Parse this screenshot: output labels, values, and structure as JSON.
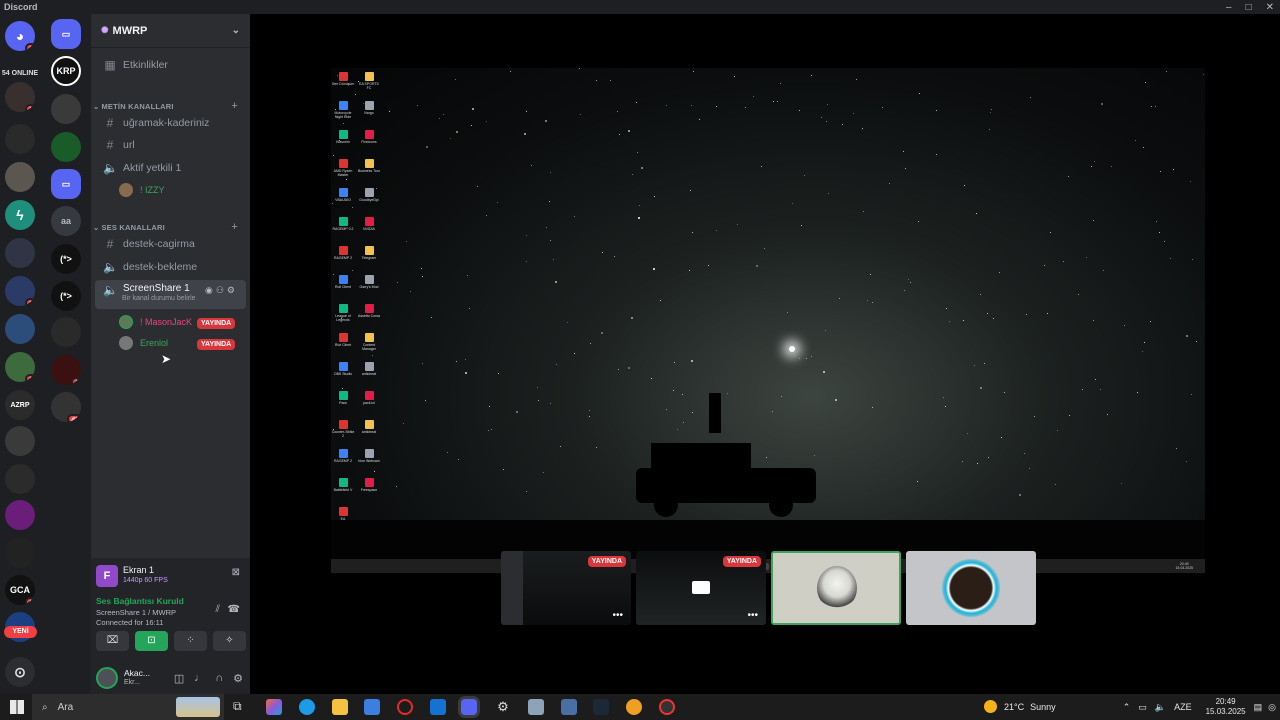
{
  "window": {
    "title": "Discord",
    "controls": [
      "–",
      "□",
      "✕"
    ]
  },
  "left_rail": {
    "online_label": "54 ONLINE",
    "new_label": "YENİ",
    "servers": [
      {
        "label": "",
        "badge": "1"
      },
      {
        "label": "",
        "badge": "2"
      },
      {
        "label": "",
        "badge": ""
      },
      {
        "label": "",
        "badge": ""
      },
      {
        "label": "",
        "badge": ""
      },
      {
        "label": "",
        "badge": ""
      },
      {
        "label": "",
        "badge": "2"
      },
      {
        "label": "",
        "badge": ""
      },
      {
        "label": "",
        "badge": "1"
      },
      {
        "label": "AZRP",
        "badge": ""
      },
      {
        "label": "",
        "badge": ""
      },
      {
        "label": "",
        "badge": ""
      },
      {
        "label": "",
        "badge": ""
      },
      {
        "label": "",
        "badge": ""
      },
      {
        "label": "GCA",
        "badge": "1"
      },
      {
        "label": "",
        "badge": ""
      }
    ]
  },
  "second_rail": {
    "servers": [
      {
        "label": "",
        "badge": ""
      },
      {
        "label": "KRP",
        "badge": ""
      },
      {
        "label": "",
        "badge": ""
      },
      {
        "label": "",
        "badge": ""
      },
      {
        "label": "",
        "badge": ""
      },
      {
        "label": "aa",
        "badge": ""
      },
      {
        "label": "(*>",
        "badge": ""
      },
      {
        "label": "(*>",
        "badge": ""
      },
      {
        "label": "",
        "badge": ""
      },
      {
        "label": "",
        "badge": "1"
      },
      {
        "label": "",
        "badge": "42"
      }
    ]
  },
  "server": {
    "name": "MWRP",
    "events_label": "Etkinlikler",
    "categories": {
      "text": "METİN KANALLARI",
      "voice": "SES KANALLARI"
    },
    "channels": {
      "text1": "uğramak-kaderiniz",
      "text2": "url",
      "voice_admin": "Aktif yetkili 1",
      "voice_admin_user": "! IZZY",
      "destek_cagirma": "destek-cagirma",
      "destek_bekleme": "destek-bekleme",
      "screenshare": "ScreenShare 1",
      "screenshare_status": "Bir kanal durumu belirle",
      "ss_user1": "! MasonJacK",
      "ss_user2": "Erenlol",
      "live_label": "YAYINDA"
    }
  },
  "panel": {
    "screen_title": "Ekran 1",
    "screen_quality": "1440p 60 FPS",
    "connection": "Ses Bağlantısı Kuruld",
    "location": "ScreenShare 1 / MWRP",
    "connected_for": "Connected for 16:11",
    "user_name": "Akac...",
    "user_status": "Ekr..."
  },
  "stream": {
    "desktop_icons": [
      "Geri Dönüşüm",
      "EA SPORTS FC",
      "Motorcycle Night Ride",
      "Nargo",
      "Klasorim",
      "Firewoms",
      "AMD Ryzen Master",
      "Business Tour",
      "VBAUDIO",
      "GoodbyeDpi",
      "RAGEMP 0.2",
      "NVIDIA",
      "RAGEMP 2",
      "Telegram",
      "Roll Client",
      "Garry's Mod",
      "League of Legends",
      "Assetto Corsa",
      "Riot Client",
      "Content Manager",
      "OBS Studio",
      "anticheat",
      "Pack",
      "pack.ini",
      "Counter-Strike 2",
      "anticheat",
      "RAGEMP 2",
      "Iriun Webcam",
      "Battlefield V",
      "Freespace",
      "EA"
    ],
    "taskbar_time": "20:49",
    "taskbar_date": "15.03.2025"
  },
  "thumbnails": {
    "live_label": "YAYINDA"
  },
  "taskbar": {
    "search_placeholder": "Ara",
    "weather_temp": "21°C",
    "weather_text": "Sunny",
    "lang": "AZE",
    "time": "20:49",
    "date": "15.03.2025"
  },
  "colors": {
    "accent_green": "#23a55a",
    "live_red": "#da373c",
    "blurple": "#5865f2"
  }
}
